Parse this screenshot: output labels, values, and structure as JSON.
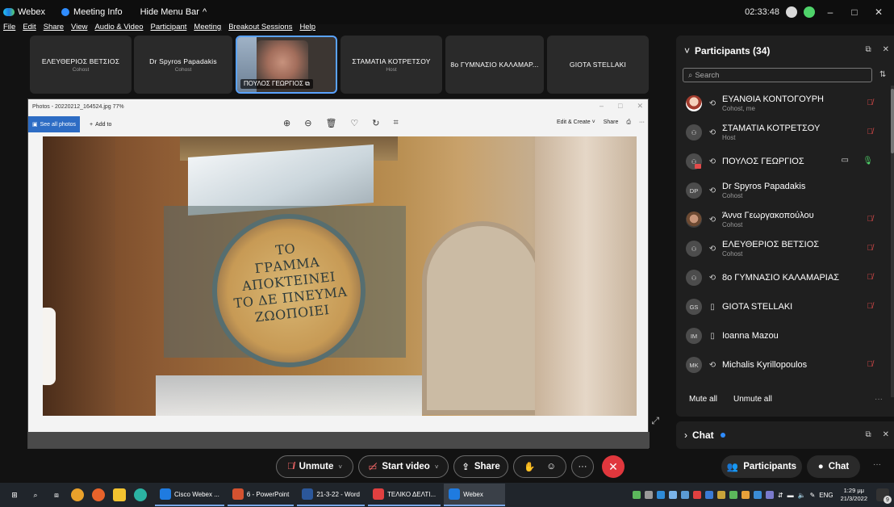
{
  "titlebar": {
    "app_name": "Webex",
    "meeting_info": "Meeting Info",
    "hide_menu": "Hide Menu Bar",
    "hide_menu_icon": "chevron-up-icon",
    "time": "02:33:48"
  },
  "menu": [
    "File",
    "Edit",
    "Share",
    "View",
    "Audio & Video",
    "Participant",
    "Meeting",
    "Breakout Sessions",
    "Help"
  ],
  "video_strip": [
    {
      "name": "ΕΛΕΥΘΕΡΙΟΣ ΒΕΤΣΙΟΣ",
      "role": "Cohost"
    },
    {
      "name": "Dr Spyros Papadakis",
      "role": "Cohost"
    },
    {
      "name": "ΠΟΥΛΟΣ ΓΕΩΡΓΙΟΣ",
      "role": ""
    },
    {
      "name": "ΣΤΑΜΑΤΙΑ ΚΟΤΡΕΤΣΟΥ",
      "role": "Host"
    },
    {
      "name": "8ο ΓΥΜΝΑΣΙΟ ΚΑΛΑΜΑΡ...",
      "role": ""
    },
    {
      "name": "GIOTA STELLAKI",
      "role": ""
    }
  ],
  "photos": {
    "title": "Photos - 20220212_164524.jpg  77%",
    "see_all": "See all photos",
    "add_to": "Add to",
    "edit_create": "Edit & Create",
    "share": "Share",
    "inscription": [
      "ΤΟ",
      "ΓΡΑΜΜΑ",
      "ΑΠΟΚΤΕΙΝΕΙ",
      "ΤΟ ΔΕ ΠΝΕΥΜΑ",
      "ΖΩΟΠΟΙΕΙ"
    ]
  },
  "participants": {
    "title": "Participants (34)",
    "search_placeholder": "Search",
    "list": [
      {
        "name": "ΕΥΑΝΘΙΑ ΚΟΝΤΟΓΟΥΡΗ",
        "role": "Cohost, me",
        "avatar": "",
        "device": "sync-icon",
        "mic": "muted"
      },
      {
        "name": "ΣΤΑΜΑΤΙΑ ΚΟΤΡΕΤΣΟΥ",
        "role": "Host",
        "avatar": "",
        "device": "sync-icon",
        "mic": "muted"
      },
      {
        "name": "ΠΟΥΛΟΣ ΓΕΩΡΓΙΟΣ",
        "role": "",
        "avatar": "",
        "device": "sync-icon",
        "mic": "on",
        "video": true
      },
      {
        "name": "Dr Spyros Papadakis",
        "role": "Cohost",
        "avatar": "DP",
        "device": "sync-icon",
        "mic": "none"
      },
      {
        "name": "Άννα Γεωργακοπούλου",
        "role": "Cohost",
        "avatar": "",
        "device": "sync-icon",
        "mic": "muted"
      },
      {
        "name": "ΕΛΕΥΘΕΡΙΟΣ ΒΕΤΣΙΟΣ",
        "role": "Cohost",
        "avatar": "",
        "device": "sync-icon",
        "mic": "muted"
      },
      {
        "name": "8ο ΓΥΜΝΑΣΙΟ ΚΑΛΑΜΑΡΙΑΣ",
        "role": "",
        "avatar": "",
        "device": "sync-icon",
        "mic": "muted"
      },
      {
        "name": "GIOTA STELLAKI",
        "role": "",
        "avatar": "GS",
        "device": "phone-icon",
        "mic": "muted"
      },
      {
        "name": "Ioanna Mazou",
        "role": "",
        "avatar": "IM",
        "device": "phone-icon",
        "mic": "none"
      },
      {
        "name": "Michalis Kyrillopoulos",
        "role": "",
        "avatar": "MK",
        "device": "sync-icon",
        "mic": "muted"
      }
    ],
    "mute_all": "Mute all",
    "unmute_all": "Unmute all"
  },
  "chat_panel": {
    "title": "Chat"
  },
  "controls": {
    "unmute": "Unmute",
    "start_video": "Start video",
    "share": "Share",
    "participants": "Participants",
    "chat": "Chat"
  },
  "taskbar": {
    "apps": [
      {
        "label": "Cisco Webex ...",
        "color": "#1f7be0"
      },
      {
        "label": "6 - PowerPoint",
        "color": "#d35230"
      },
      {
        "label": "21-3-22 - Word",
        "color": "#2b579a"
      },
      {
        "label": "ΤΕΛΙΚΟ ΔΕΛΤΙ...",
        "color": "#e04040"
      },
      {
        "label": "Webex",
        "color": "#1f7be0"
      }
    ],
    "lang": "ENG",
    "time": "1:29 μμ",
    "date": "21/3/2022"
  }
}
